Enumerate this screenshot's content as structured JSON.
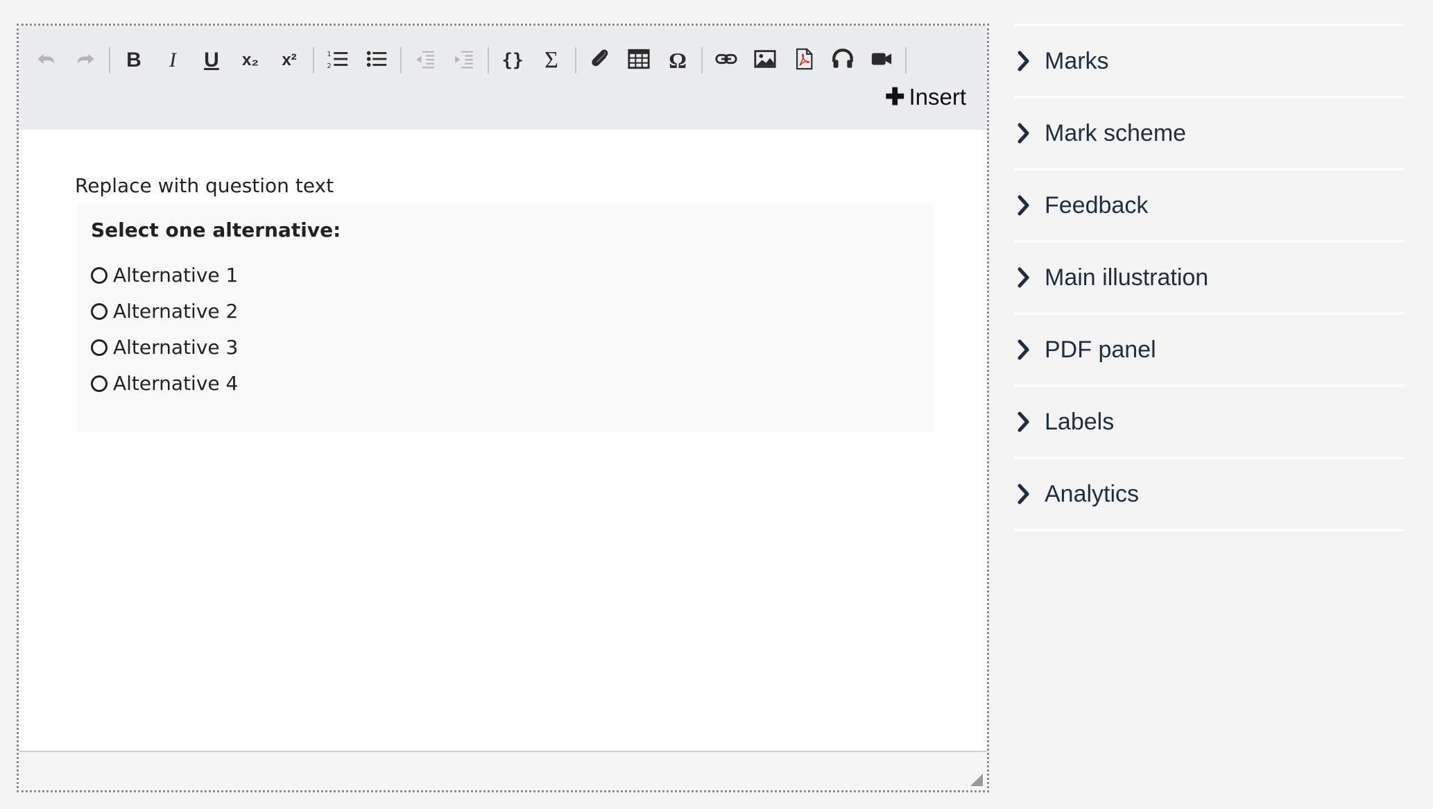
{
  "toolbar": {
    "insert_label": "Insert",
    "groups": [
      [
        {
          "icon": "undo-icon",
          "disabled": true
        },
        {
          "icon": "redo-icon",
          "disabled": true
        }
      ],
      [
        {
          "icon": "bold-icon",
          "glyph": "B"
        },
        {
          "icon": "italic-icon",
          "glyph": "I"
        },
        {
          "icon": "underline-icon",
          "glyph": "U"
        },
        {
          "icon": "subscript-icon",
          "glyph": "x₂"
        },
        {
          "icon": "superscript-icon",
          "glyph": "x²"
        }
      ],
      [
        {
          "icon": "numbered-list-icon"
        },
        {
          "icon": "bulleted-list-icon"
        }
      ],
      [
        {
          "icon": "outdent-icon",
          "disabled": true
        },
        {
          "icon": "indent-icon",
          "disabled": true
        }
      ],
      [
        {
          "icon": "code-braces-icon",
          "glyph": "{}"
        },
        {
          "icon": "sigma-icon",
          "glyph": "Σ"
        }
      ],
      [
        {
          "icon": "attachment-icon"
        },
        {
          "icon": "table-icon"
        },
        {
          "icon": "omega-icon",
          "glyph": "Ω"
        }
      ],
      [
        {
          "icon": "link-icon"
        },
        {
          "icon": "image-icon"
        },
        {
          "icon": "pdf-icon"
        },
        {
          "icon": "headphones-icon"
        },
        {
          "icon": "video-icon"
        }
      ]
    ]
  },
  "editor": {
    "question_text": "Replace with question text",
    "choice_title": "Select one alternative:",
    "alternatives": [
      "Alternative 1",
      "Alternative 2",
      "Alternative 3",
      "Alternative 4"
    ]
  },
  "sidebar": {
    "items": [
      {
        "label": "Marks"
      },
      {
        "label": "Mark scheme"
      },
      {
        "label": "Feedback"
      },
      {
        "label": "Main illustration"
      },
      {
        "label": "PDF panel"
      },
      {
        "label": "Labels"
      },
      {
        "label": "Analytics"
      }
    ]
  },
  "colors": {
    "toolbar_bg": "#ebecee",
    "page_bg": "#f4f4f4",
    "accordion_text": "#1f2d3d"
  }
}
